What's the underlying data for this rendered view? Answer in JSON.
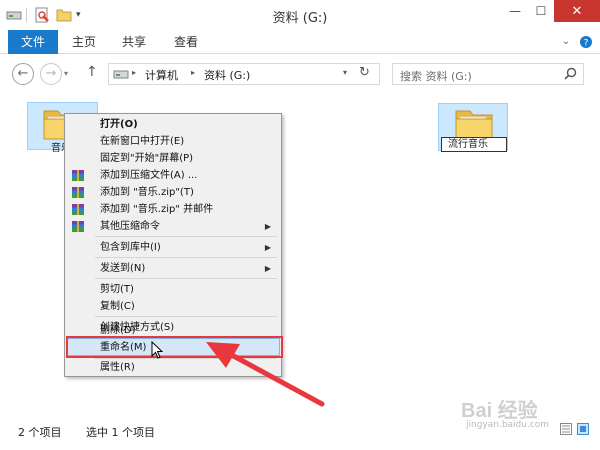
{
  "window": {
    "title": "资料 (G:)",
    "controls": {
      "minimize": "—",
      "maximize": "☐",
      "close": "✕"
    }
  },
  "ribbon": {
    "tabs": [
      "文件",
      "主页",
      "共享",
      "查看"
    ]
  },
  "address": {
    "path": [
      "计算机",
      "资料 (G:)"
    ],
    "separator": "▸",
    "search_placeholder": "搜索 资料 (G:)"
  },
  "files": [
    {
      "name": "音乐",
      "selected": true
    },
    {
      "name": "流行音乐",
      "renaming": true
    }
  ],
  "context_menu": {
    "items": [
      {
        "label": "打开(O)",
        "bold": true
      },
      {
        "label": "在新窗口中打开(E)"
      },
      {
        "label": "固定到\"开始\"屏幕(P)"
      },
      {
        "label": "添加到压缩文件(A) ...",
        "icon": "winrar-icon"
      },
      {
        "label": "添加到 \"音乐.zip\"(T)",
        "icon": "winrar-icon"
      },
      {
        "label": "添加到 \"音乐.zip\" 并邮件",
        "icon": "winrar-icon"
      },
      {
        "label": "其他压缩命令",
        "icon": "winrar-icon",
        "submenu": true
      },
      {
        "label": "包含到库中(I)",
        "submenu": true
      },
      {
        "label": "发送到(N)",
        "submenu": true
      },
      {
        "label": "剪切(T)"
      },
      {
        "label": "复制(C)"
      },
      {
        "label": "创建快捷方式(S)"
      },
      {
        "label": "删除(D)"
      },
      {
        "label": "重命名(M)",
        "highlighted": true
      },
      {
        "label": "属性(R)"
      }
    ]
  },
  "status": {
    "item_count": "2 个项目",
    "selected_count": "选中 1 个项目"
  },
  "watermark": {
    "brand": "Bai 经验",
    "url": "jingyan.baidu.com"
  },
  "colors": {
    "accent": "#1979ca",
    "selection": "#cce8ff",
    "menu_bg": "#f0f0f0",
    "annotation": "#e8383d"
  }
}
